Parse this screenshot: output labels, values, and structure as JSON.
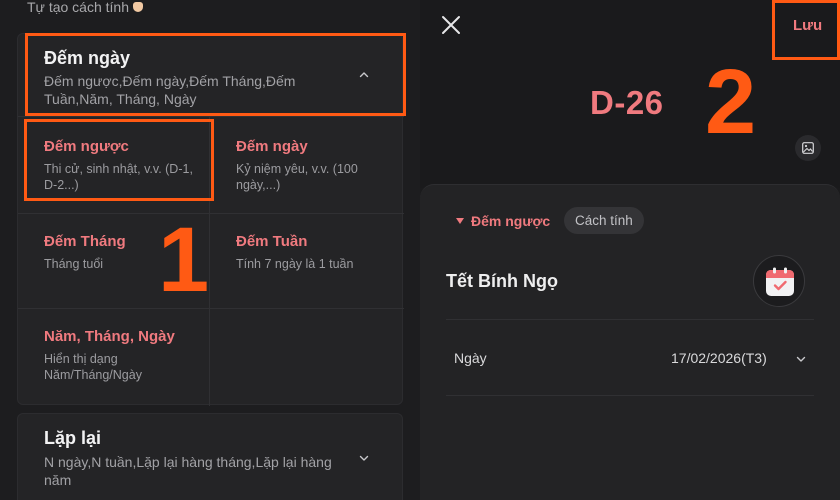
{
  "left": {
    "hint": "Tự tạo cách tính",
    "section_count": {
      "title": "Đếm ngày",
      "subtitle": "Đếm ngược,Đếm ngày,Đếm Tháng,Đếm Tuần,Năm, Tháng, Ngày",
      "options": [
        {
          "title": "Đếm ngược",
          "desc": "Thi cử, sinh nhật, v.v. (D-1, D-2...)"
        },
        {
          "title": "Đếm ngày",
          "desc": "Kỷ niệm yêu, v.v. (100 ngày,...)"
        },
        {
          "title": "Đếm Tháng",
          "desc": "Tháng tuổi"
        },
        {
          "title": "Đếm Tuần",
          "desc": "Tính 7 ngày là 1 tuần"
        },
        {
          "title": "Năm, Tháng, Ngày",
          "desc": "Hiển thị dạng Năm/Tháng/Ngày"
        }
      ]
    },
    "section_repeat": {
      "title": "Lặp lại",
      "subtitle": "N ngày,N tuần,Lặp lại hàng tháng,Lặp lại hàng năm"
    },
    "step_label": "1"
  },
  "right": {
    "save_label": "Lưu",
    "dday": "D-26",
    "step_label": "2",
    "mode": "Đếm ngược",
    "method_chip": "Cách tính",
    "event_title": "Tết Bính Ngọ",
    "date_label": "Ngày",
    "date_value": "17/02/2026(T3)"
  },
  "colors": {
    "accent": "#f07a7f",
    "highlight": "#ff5a14",
    "background": "#1b1b1d"
  },
  "icons": [
    "close-icon",
    "image-icon",
    "calendar-check-icon",
    "chevron-up-icon",
    "chevron-down-icon",
    "pointing-hand-icon",
    "triangle-down-icon"
  ]
}
